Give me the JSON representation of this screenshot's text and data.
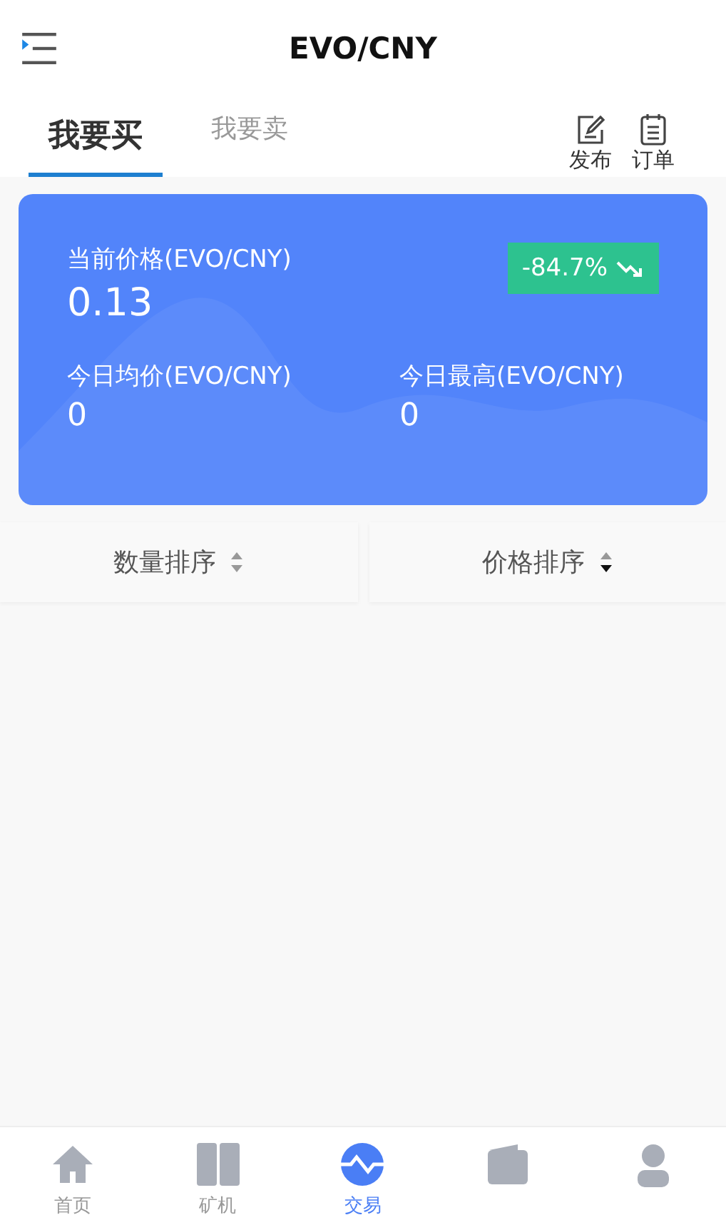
{
  "header": {
    "title": "EVO/CNY"
  },
  "tabs": [
    {
      "label": "我要买",
      "selected": true
    },
    {
      "label": "我要卖",
      "selected": false
    }
  ],
  "actions": [
    {
      "label": "发布",
      "kind": "edit"
    },
    {
      "label": "订单",
      "kind": "list"
    }
  ],
  "price_card": {
    "label": "当前价格(EVO/CNY)",
    "value": "0.13",
    "change": {
      "text": "-84.7%",
      "kind": "down"
    },
    "stats": [
      {
        "label": "今日均价(EVO/CNY)",
        "value": "0"
      },
      {
        "label": "今日最高(EVO/CNY)",
        "value": "0"
      }
    ]
  },
  "sort": [
    {
      "label": "数量排序",
      "selected": false
    },
    {
      "label": "价格排序",
      "selected": true
    }
  ],
  "nav": [
    {
      "label": "首页",
      "kind": "home",
      "selected": false
    },
    {
      "label": "矿机",
      "kind": "machine",
      "selected": false
    },
    {
      "label": "交易",
      "kind": "trade",
      "selected": true
    },
    {
      "kind": "wallet",
      "selected": false
    },
    {
      "kind": "user",
      "selected": false
    }
  ]
}
